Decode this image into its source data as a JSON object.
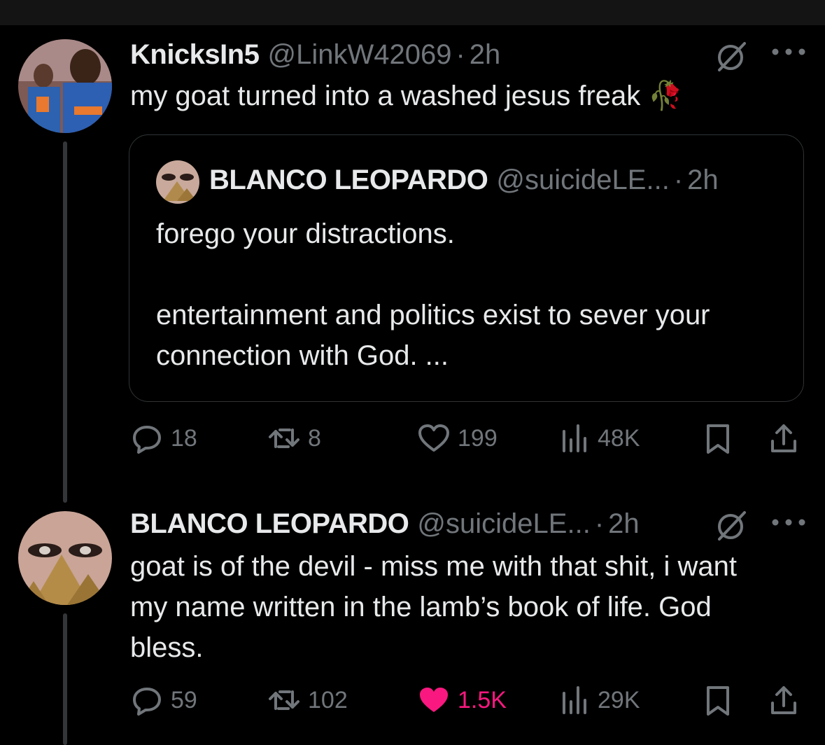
{
  "colors": {
    "background": "#000000",
    "text": "#e7e9ea",
    "muted": "#71767b",
    "like_active": "#f91880",
    "border": "#2f3336"
  },
  "tweet1": {
    "display_name": "KnicksIn5",
    "handle": "@LinkW42069",
    "dot": "·",
    "time": "2h",
    "text": "my goat turned into a washed jesus freak",
    "emoji": "🥀",
    "quote": {
      "display_name": "BLANCO LEOPARDO",
      "handle": "@suicideLE...",
      "dot": "·",
      "time": "2h",
      "paragraph1": "forego your distractions.",
      "paragraph2": "entertainment and politics exist to sever your connection with God. ..."
    },
    "stats": {
      "replies": "18",
      "retweets": "8",
      "likes": "199",
      "views": "48K"
    }
  },
  "tweet2": {
    "display_name": "BLANCO LEOPARDO",
    "handle": "@suicideLE...",
    "dot": "·",
    "time": "2h",
    "text": "goat is of the devil - miss me with that shit, i want my name written in the lamb’s book of life. God bless.",
    "stats": {
      "replies": "59",
      "retweets": "102",
      "likes": "1.5K",
      "liked": true,
      "views": "29K"
    }
  },
  "icons": [
    "grok-icon",
    "more-icon",
    "reply-icon",
    "retweet-icon",
    "like-icon",
    "views-icon",
    "bookmark-icon",
    "share-icon"
  ]
}
